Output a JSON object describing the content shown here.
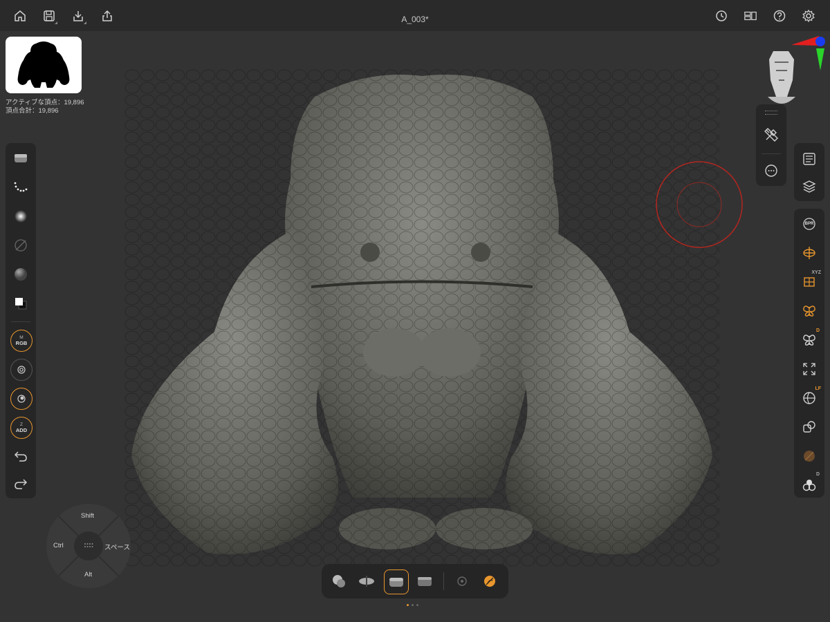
{
  "header": {
    "title": "A_003*",
    "left_tools": [
      "home-icon",
      "save-icon",
      "import-icon",
      "share-icon"
    ],
    "right_tools": [
      "history-icon",
      "layout-icon",
      "help-icon",
      "gear-icon"
    ]
  },
  "scene_info": {
    "active_vertices": "アクティブな頂点：19,896",
    "total_vertices": "頂点合計：19,896"
  },
  "left_toolbar": {
    "mask_buttons": [
      {
        "top": "M",
        "bottom": "RGB"
      },
      {
        "top": "",
        "bottom": ""
      },
      {
        "top": "",
        "bottom": ""
      },
      {
        "top": "Z",
        "bottom": "ADD"
      }
    ]
  },
  "right_toolbar": {
    "badges": {
      "xyz": "XYZ",
      "d1": "D",
      "lf": "LF",
      "d2": "D"
    },
    "bpr_label": "BPR"
  },
  "joystick": {
    "up": "Shift",
    "left": "Ctrl",
    "right": "スペース",
    "down": "Alt"
  },
  "dock": {
    "active_index": 2,
    "page_count": 3,
    "current_page": 0
  },
  "colors": {
    "accent": "#e8962d",
    "background": "#333334",
    "bar": "#2a2a2b",
    "brush_ring": "#b3261e"
  }
}
